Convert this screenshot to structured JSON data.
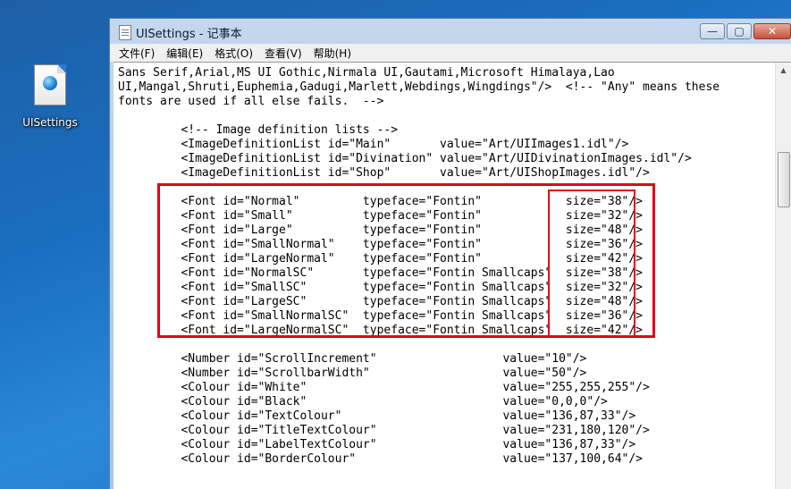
{
  "desktop": {
    "icon_label": "UISettings"
  },
  "window": {
    "title": "UISettings - 记事本",
    "controls": {
      "minimize": "—",
      "maximize": "▢",
      "close": "✕"
    }
  },
  "menu": [
    "文件(F)",
    "编辑(E)",
    "格式(O)",
    "查看(V)",
    "帮助(H)"
  ],
  "document": {
    "lines": [
      "Sans Serif,Arial,MS UI Gothic,Nirmala UI,Gautami,Microsoft Himalaya,Lao",
      "UI,Mangal,Shruti,Euphemia,Gadugi,Marlett,Webdings,Wingdings\"/>  <!-- \"Any\" means these",
      "fonts are used if all else fails.  -->",
      "",
      "         <!-- Image definition lists -->",
      "         <ImageDefinitionList id=\"Main\"       value=\"Art/UIImages1.idl\"/>",
      "         <ImageDefinitionList id=\"Divination\" value=\"Art/UIDivinationImages.idl\"/>",
      "         <ImageDefinitionList id=\"Shop\"       value=\"Art/UIShopImages.idl\"/>",
      "",
      "         <Font id=\"Normal\"         typeface=\"Fontin\"            size=\"38\"/>",
      "         <Font id=\"Small\"          typeface=\"Fontin\"            size=\"32\"/>",
      "         <Font id=\"Large\"          typeface=\"Fontin\"            size=\"48\"/>",
      "         <Font id=\"SmallNormal\"    typeface=\"Fontin\"            size=\"36\"/>",
      "         <Font id=\"LargeNormal\"    typeface=\"Fontin\"            size=\"42\"/>",
      "         <Font id=\"NormalSC\"       typeface=\"Fontin Smallcaps\"  size=\"38\"/>",
      "         <Font id=\"SmallSC\"        typeface=\"Fontin Smallcaps\"  size=\"32\"/>",
      "         <Font id=\"LargeSC\"        typeface=\"Fontin Smallcaps\"  size=\"48\"/>",
      "         <Font id=\"SmallNormalSC\"  typeface=\"Fontin Smallcaps\"  size=\"36\"/>",
      "         <Font id=\"LargeNormalSC\"  typeface=\"Fontin Smallcaps\"  size=\"42\"/>",
      "",
      "         <Number id=\"ScrollIncrement\"                  value=\"10\"/>",
      "         <Number id=\"ScrollbarWidth\"                   value=\"50\"/>",
      "         <Colour id=\"White\"                            value=\"255,255,255\"/>",
      "         <Colour id=\"Black\"                            value=\"0,0,0\"/>",
      "         <Colour id=\"TextColour\"                       value=\"136,87,33\"/>",
      "         <Colour id=\"TitleTextColour\"                  value=\"231,180,120\"/>",
      "         <Colour id=\"LabelTextColour\"                  value=\"136,87,33\"/>",
      "         <Colour id=\"BorderColour\"                     value=\"137,100,64\"/>"
    ]
  },
  "colors": {
    "highlight": "#e4001b"
  }
}
